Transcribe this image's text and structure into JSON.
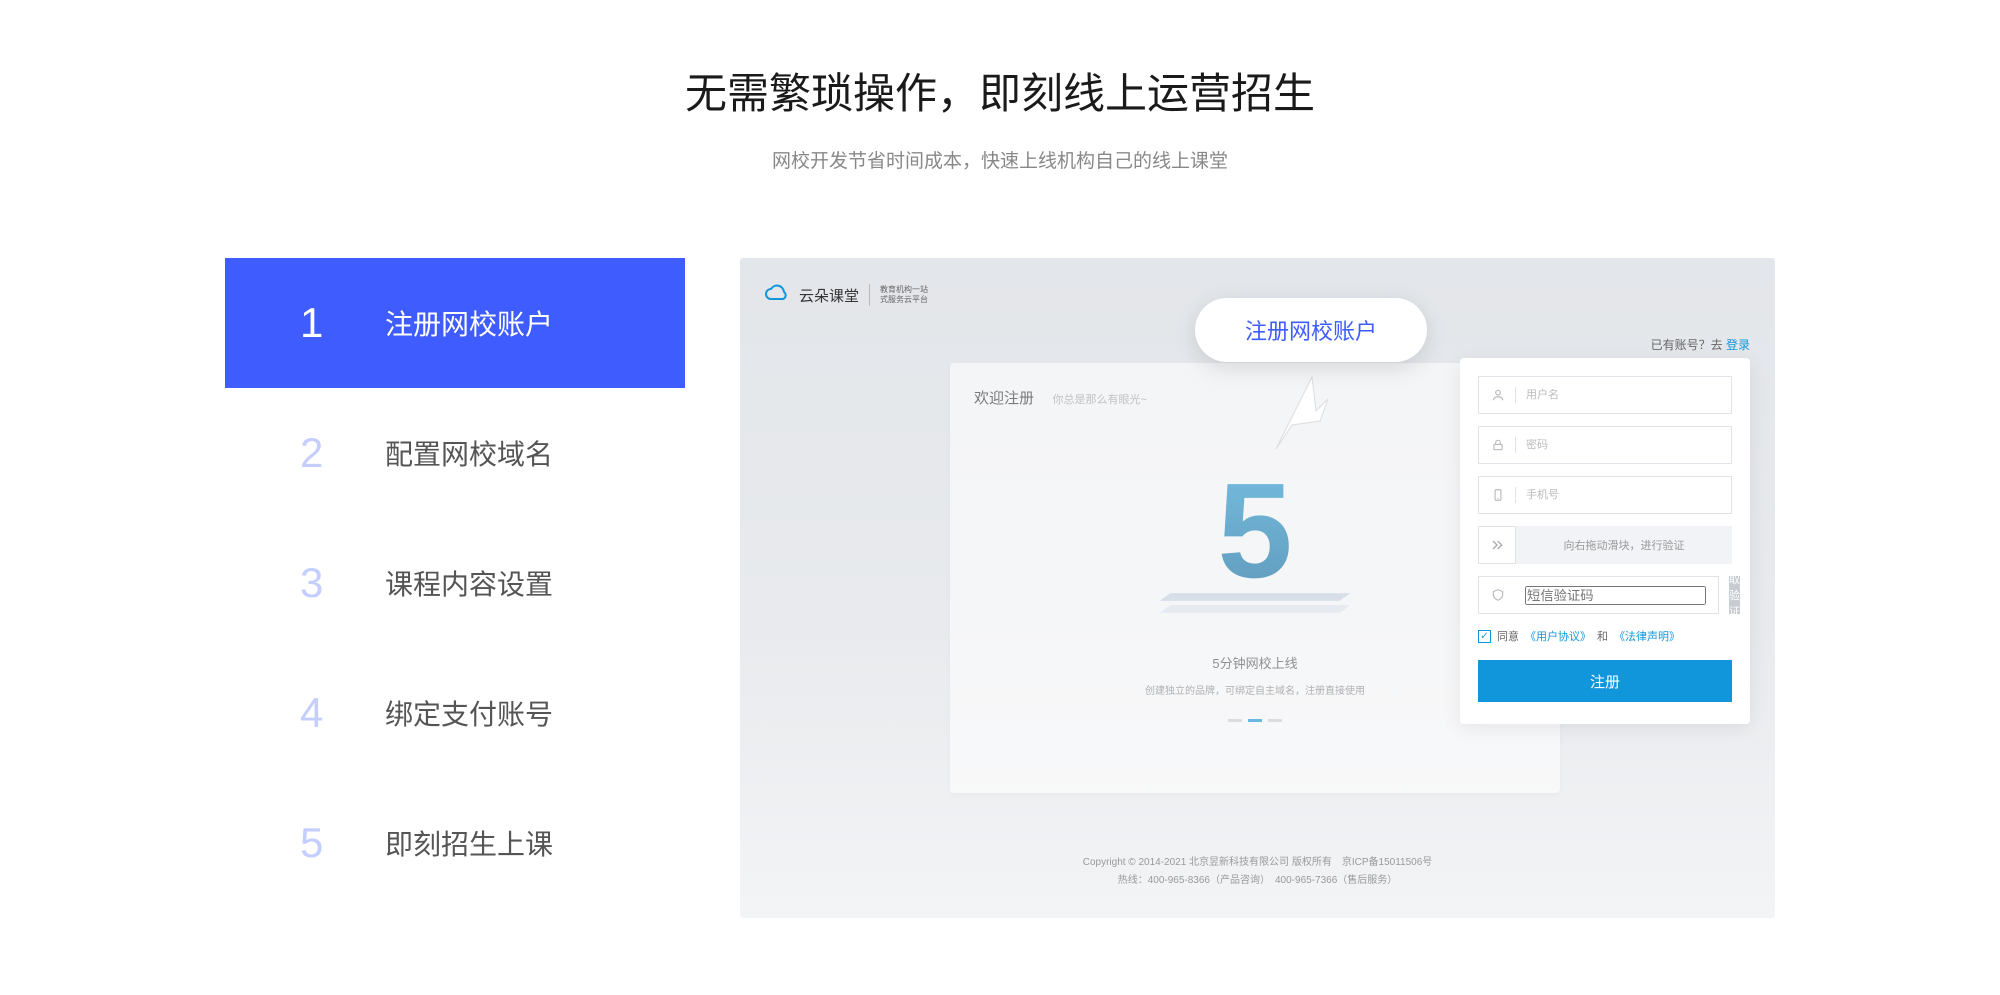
{
  "header": {
    "title": "无需繁琐操作，即刻线上运营招生",
    "subtitle": "网校开发节省时间成本，快速上线机构自己的线上课堂"
  },
  "sidebar": {
    "items": [
      {
        "num": "1",
        "label": "注册网校账户",
        "active": true
      },
      {
        "num": "2",
        "label": "配置网校域名",
        "active": false
      },
      {
        "num": "3",
        "label": "课程内容设置",
        "active": false
      },
      {
        "num": "4",
        "label": "绑定支付账号",
        "active": false
      },
      {
        "num": "5",
        "label": "即刻招生上课",
        "active": false
      }
    ]
  },
  "preview": {
    "logo_text": "云朵课堂",
    "logo_sub_line1": "教育机构一站",
    "logo_sub_line2": "式服务云平台",
    "already_text": "已有账号？去 ",
    "login_link": "登录",
    "welcome_title": "欢迎注册",
    "welcome_sub": "你总是那么有眼光~",
    "big5_caption": "5分钟网校上线",
    "big5_desc": "创建独立的品牌，可绑定自主域名，注册直接使用",
    "form": {
      "username_placeholder": "用户名",
      "password_placeholder": "密码",
      "phone_placeholder": "手机号",
      "slider_text": "向右拖动滑块，进行验证",
      "sms_placeholder": "短信验证码",
      "sms_button": "获取验证码",
      "agree_prefix": "同意",
      "agree_user": "《用户协议》",
      "agree_and": "和",
      "agree_law": "《法律声明》",
      "register_button": "注册"
    },
    "footer_line1": "Copyright © 2014-2021 北京昱新科技有限公司 版权所有　京ICP备15011506号",
    "footer_line2": "热线：400-965-8366（产品咨询）　400-965-7366（售后服务）",
    "tooltip": "注册网校账户"
  }
}
